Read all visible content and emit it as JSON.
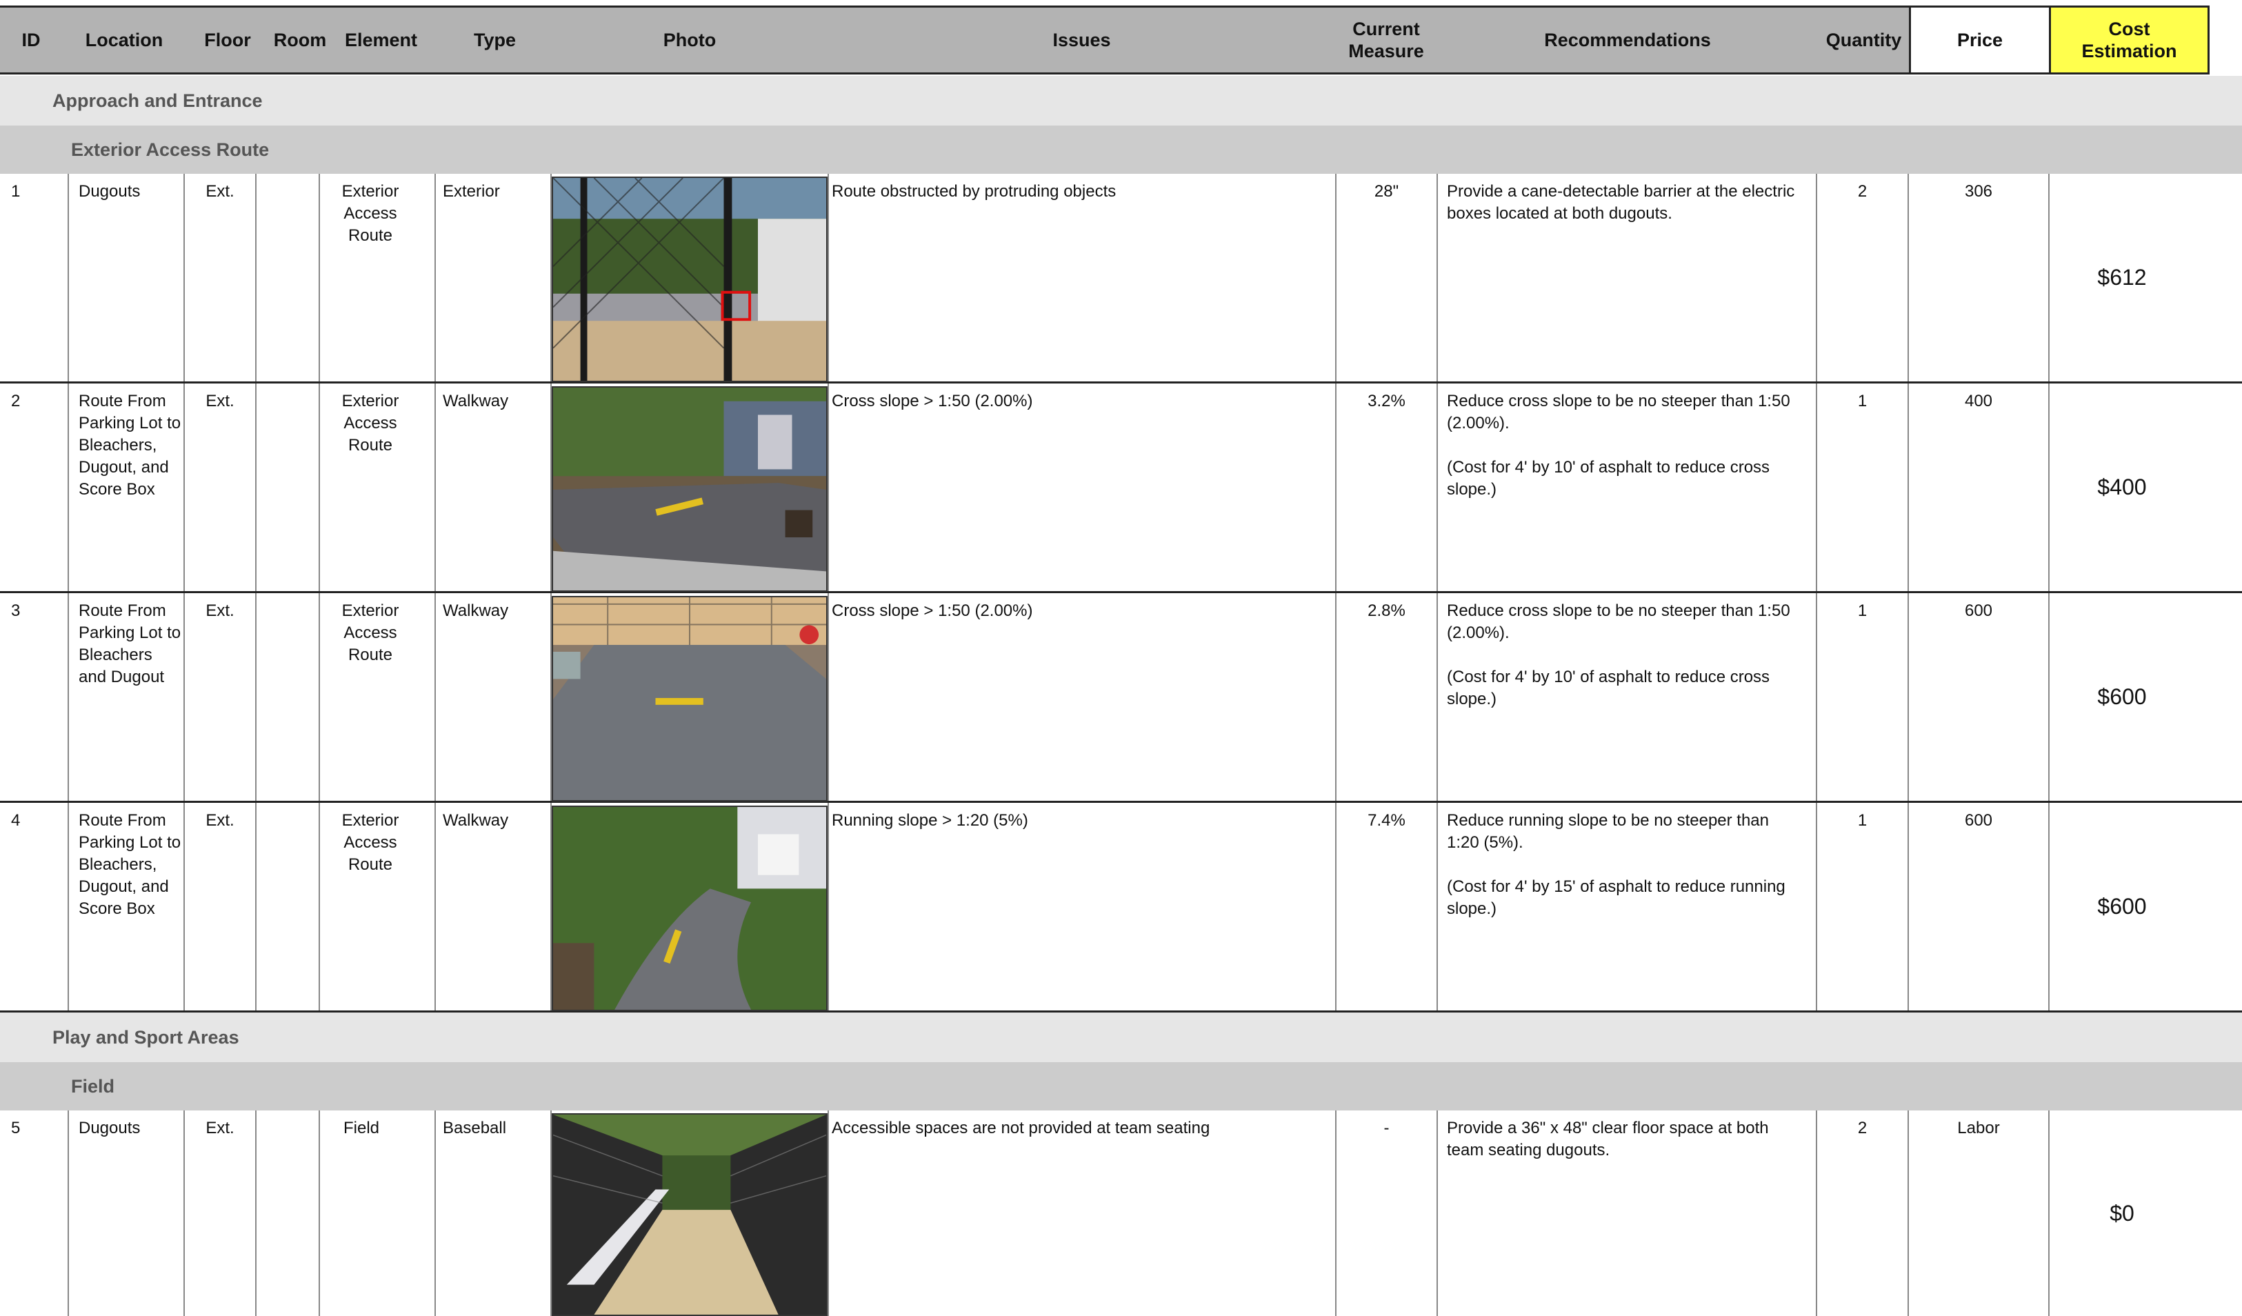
{
  "headers": {
    "id": "ID",
    "location": "Location",
    "floor": "Floor",
    "room": "Room",
    "element": "Element",
    "type": "Type",
    "photo": "Photo",
    "issues": "Issues",
    "current_measure": "Current\nMeasure",
    "recommendations": "Recommendations",
    "quantity": "Quantity",
    "price": "Price",
    "cost_estimation": "Cost\nEstimation"
  },
  "sections": [
    {
      "title": "Approach and Entrance",
      "subsection": "Exterior Access Route"
    },
    {
      "title": "Play and Sport Areas",
      "subsection": "Field"
    }
  ],
  "rows": [
    {
      "id": "1",
      "location": "Dugouts",
      "floor": "Ext.",
      "room": "",
      "element": "Exterior\nAccess\nRoute",
      "type": "Exterior",
      "issue": "Route obstructed by protruding objects",
      "measure": "28\"",
      "recommendation": "Provide a cane-detectable barrier at the electric\nboxes located at both dugouts.",
      "quantity": "2",
      "price": "306",
      "cost": "$612"
    },
    {
      "id": "2",
      "location": "Route From\nParking Lot to\nBleachers,\nDugout, and\nScore Box",
      "floor": "Ext.",
      "room": "",
      "element": "Exterior\nAccess\nRoute",
      "type": "Walkway",
      "issue": "Cross slope > 1:50 (2.00%)",
      "measure": "3.2%",
      "recommendation": "Reduce cross slope to be no steeper than 1:50\n(2.00%).\n\n(Cost for 4' by 10' of asphalt to reduce cross\nslope.)",
      "quantity": "1",
      "price": "400",
      "cost": "$400"
    },
    {
      "id": "3",
      "location": "Route From\nParking Lot to\nBleachers\nand Dugout",
      "floor": "Ext.",
      "room": "",
      "element": "Exterior\nAccess\nRoute",
      "type": "Walkway",
      "issue": "Cross slope > 1:50 (2.00%)",
      "measure": "2.8%",
      "recommendation": "Reduce cross slope to be no steeper than 1:50\n(2.00%).\n\n(Cost for 4' by 10' of asphalt to reduce cross\nslope.)",
      "quantity": "1",
      "price": "600",
      "cost": "$600"
    },
    {
      "id": "4",
      "location": "Route From\nParking Lot to\nBleachers,\nDugout, and\nScore Box",
      "floor": "Ext.",
      "room": "",
      "element": "Exterior\nAccess\nRoute",
      "type": "Walkway",
      "issue": "Running slope > 1:20 (5%)",
      "measure": "7.4%",
      "recommendation": "Reduce running slope to be no steeper than\n1:20 (5%).\n\n(Cost for 4' by 15' of asphalt to reduce running\nslope.)",
      "quantity": "1",
      "price": "600",
      "cost": "$600"
    },
    {
      "id": "5",
      "location": "Dugouts",
      "floor": "Ext.",
      "room": "",
      "element": "Field",
      "type": "Baseball",
      "issue": "Accessible spaces are not provided at team seating",
      "measure": "-",
      "recommendation": "Provide a 36\" x 48\" clear floor space at both\nteam seating dugouts.",
      "quantity": "2",
      "price": "Labor",
      "cost": "$0"
    }
  ],
  "colors": {
    "header_bg": "#b3b3b3",
    "cost_header_bg": "#ffff4d",
    "section_bg": "#e6e6e6",
    "subsection_bg": "#cccccc"
  }
}
